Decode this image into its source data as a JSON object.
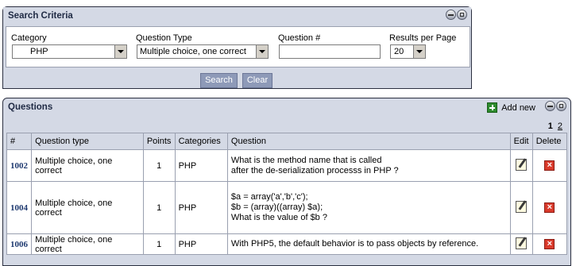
{
  "search": {
    "title": "Search Criteria",
    "category_label": "Category",
    "category_value": "PHP",
    "question_type_label": "Question Type",
    "question_type_value": "Multiple choice, one correct",
    "question_num_label": "Question #",
    "question_num_value": "",
    "results_label": "Results per Page",
    "results_value": "20",
    "search_button": "Search",
    "clear_button": "Clear"
  },
  "questions": {
    "title": "Questions",
    "add_new": "Add new",
    "pager": {
      "current": "1",
      "next": "2"
    },
    "columns": [
      "#",
      "Question type",
      "Points",
      "Categories",
      "Question",
      "Edit",
      "Delete"
    ],
    "rows": [
      {
        "id": "1002",
        "type": "Multiple choice, one correct",
        "points": "1",
        "category": "PHP",
        "question_lines": [
          "What is the method name that is called",
          "after the de-serialization processs in PHP ?"
        ]
      },
      {
        "id": "1004",
        "type": "Multiple choice, one correct",
        "points": "1",
        "category": "PHP",
        "question_lines": [
          "$a = array('a','b','c');",
          "$b = (array)((array) $a);",
          "",
          "What is the value of $b ?"
        ]
      },
      {
        "id": "1006",
        "type": "Multiple choice, one correct",
        "points": "1",
        "category": "PHP",
        "question_lines": [
          "With PHP5, the default behavior is to pass objects by reference."
        ]
      }
    ]
  },
  "colors": {
    "panel_bg": "#d4d9e5",
    "button_bg": "#8e9ab8",
    "id_color": "#1f3a70",
    "delete_red": "#d93a2b"
  },
  "icons": {
    "minimize": "minimize-icon",
    "maximize": "maximize-icon",
    "add": "add-icon",
    "edit": "edit-icon",
    "delete": "delete-icon"
  }
}
